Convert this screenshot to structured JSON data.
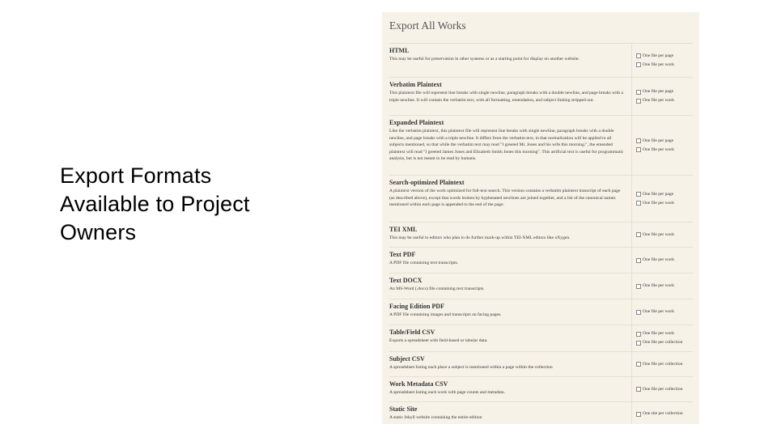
{
  "slide": {
    "title": "Export Formats Available to Project Owners"
  },
  "panel": {
    "title": "Export All Works",
    "formats": [
      {
        "name": "HTML",
        "description": "This may be useful for preservation in other systems or as a starting point for display on another website.",
        "options": [
          "One file per page",
          "One file per work"
        ]
      },
      {
        "name": "Verbatim Plaintext",
        "description": "This plaintext file will represent line breaks with single newline, paragraph breaks with a double newline, and page breaks with a triple newline. It will contain the verbatim text, with all formatting, emendation, and subject linking stripped out.",
        "options": [
          "One file per page",
          "One file per work"
        ]
      },
      {
        "name": "Expanded Plaintext",
        "description": "Like the verbatim plaintext, this plaintext file will represent line breaks with single newline, paragraph breaks with a double newline, and page breaks with a triple newline. It differs from the verbatim text, in that normalization will be applied to all subjects mentioned, so that while the verbatim text may read \"I greeted Mr. Jones and his wife this morning.\", the emended plaintext will read \"I greeted James Jones and Elizabeth Smith Jones this morning\". This artificial text is useful for programmatic analysis, but is not meant to be read by humans.",
        "options": [
          "One file per page",
          "One file per work"
        ]
      },
      {
        "name": "Search-optimized Plaintext",
        "description": "A plaintext version of the work optimized for full-text search. This version contains a verbatim plaintext transcript of each page (as described above), except that words broken by hyphenated newlines are joined together, and a list of the canonical names mentioned within each page is appended to the end of the page.",
        "options": [
          "One file per page",
          "One file per work"
        ]
      },
      {
        "name": "TEI XML",
        "description": "This may be useful to editors who plan to do further mark-up within TEI-XML editors like oXygen.",
        "options": [
          "One file per work"
        ]
      },
      {
        "name": "Text PDF",
        "description": "A PDF file containing text transcripts.",
        "options": [
          "One file per work"
        ]
      },
      {
        "name": "Text DOCX",
        "description": "An MS-Word (.docx) file containing text transcripts.",
        "options": [
          "One file per work"
        ]
      },
      {
        "name": "Facing Edition PDF",
        "description": "A PDF file containing images and transcripts on facing pages.",
        "options": [
          "One file per work"
        ]
      },
      {
        "name": "Table/Field CSV",
        "description": "Exports a spreadsheet with field-based or tabular data.",
        "options": [
          "One file per work",
          "One file per collection"
        ]
      },
      {
        "name": "Subject CSV",
        "description": "A spreadsheet listing each place a subject is mentioned within a page within the collection",
        "options": [
          "One file per collection"
        ]
      },
      {
        "name": "Work Metadata CSV",
        "description": "A spreadsheet listing each work with page counts and metadata.",
        "options": [
          "One file per collection"
        ]
      },
      {
        "name": "Static Site",
        "description": "A static Jekyll website containing the entire edition",
        "options": [
          "One site per collection"
        ]
      }
    ]
  }
}
